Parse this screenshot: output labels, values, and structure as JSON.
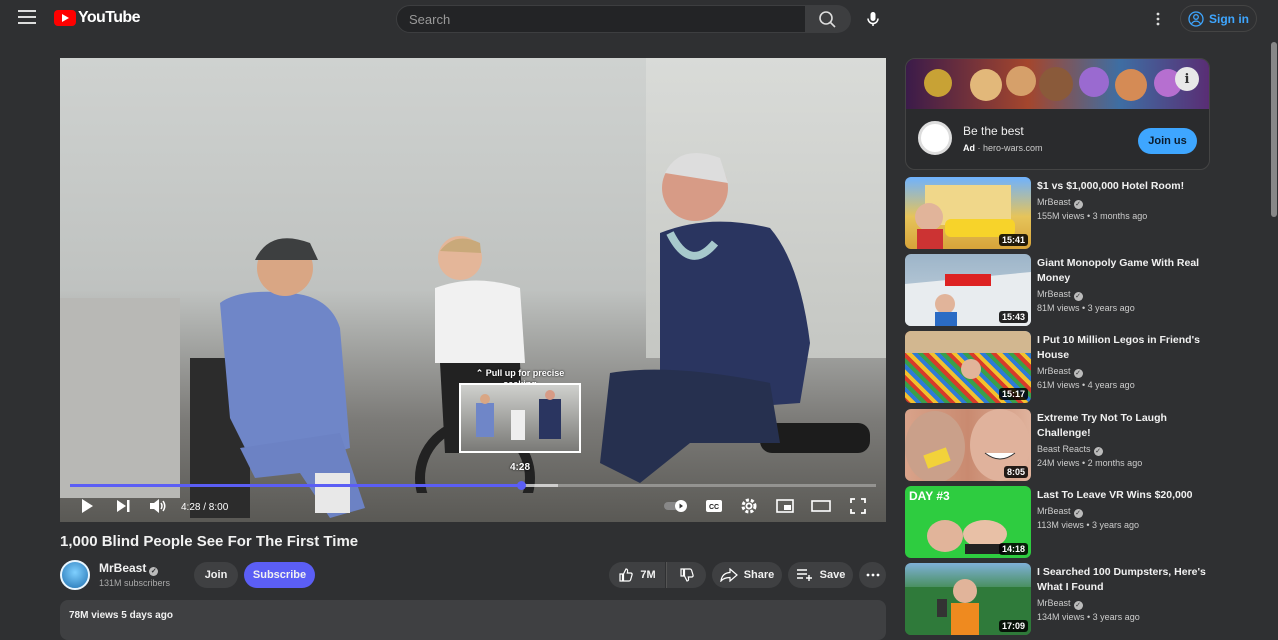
{
  "header": {
    "logo_text": "YouTube",
    "search_placeholder": "Search",
    "signin_label": "Sign in"
  },
  "player": {
    "seek_hint": "⌃ Pull up for precise seeking",
    "preview_time": "4:28",
    "timecode": "4:28 / 8:00",
    "progress_fraction": 0.56,
    "buffer_fraction": 0.605,
    "accent_color": "#5b5ef5"
  },
  "video": {
    "title": "1,000 Blind People See For The First Time",
    "channel": "MrBeast",
    "subscribers": "131M subscribers",
    "join_label": "Join",
    "subscribe_label": "Subscribe",
    "likes": "7M",
    "share_label": "Share",
    "save_label": "Save",
    "description_meta": "78M views  5 days ago"
  },
  "ad": {
    "title": "Be the best",
    "ad_badge": "Ad",
    "domain": "· hero-wars.com",
    "cta_label": "Join us"
  },
  "recommendations": [
    {
      "title": "$1 vs $1,000,000 Hotel Room!",
      "channel": "MrBeast",
      "meta": "155M views • 3 months ago",
      "duration": "15:41"
    },
    {
      "title": "Giant Monopoly Game With Real Money",
      "channel": "MrBeast",
      "meta": "81M views • 3 years ago",
      "duration": "15:43"
    },
    {
      "title": "I Put 10 Million Legos in Friend's House",
      "channel": "MrBeast",
      "meta": "61M views • 4 years ago",
      "duration": "15:17"
    },
    {
      "title": "Extreme Try Not To Laugh Challenge!",
      "channel": "Beast Reacts",
      "meta": "24M views • 2 months ago",
      "duration": "8:05"
    },
    {
      "title": "Last To Leave VR Wins $20,000",
      "channel": "MrBeast",
      "meta": "113M views • 3 years ago",
      "duration": "14:18"
    },
    {
      "title": "I Searched 100 Dumpsters, Here's What I Found",
      "channel": "MrBeast",
      "meta": "134M views • 3 years ago",
      "duration": "17:09"
    }
  ]
}
